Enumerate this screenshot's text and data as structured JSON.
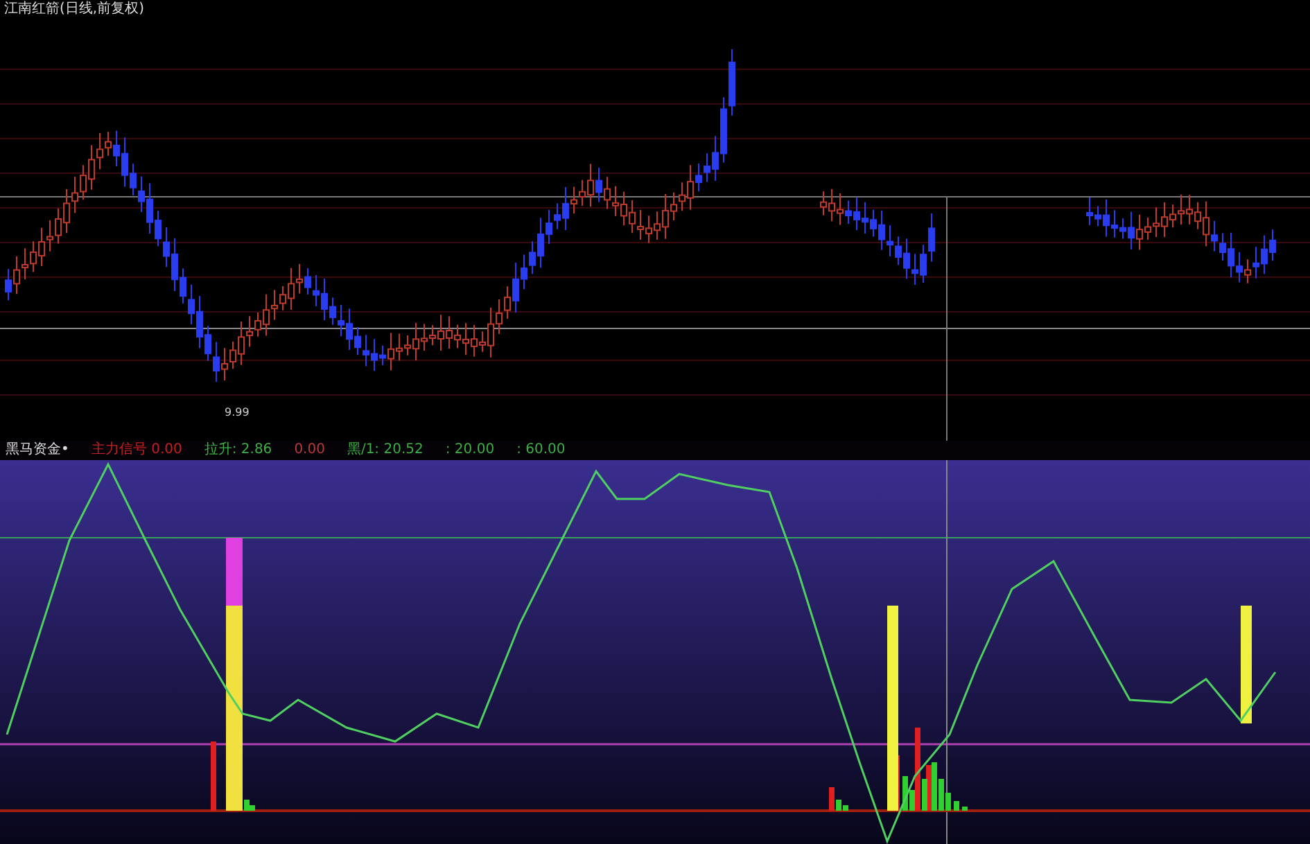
{
  "window": {
    "title": "江南红箭(日线,前复权)"
  },
  "price_chart": {
    "low_label": "9.99"
  },
  "indicator": {
    "name": "黑马资金•",
    "values": [
      {
        "text": "主力信号 0.00",
        "color": "#c82020"
      },
      {
        "text": "拉升: 2.86",
        "color": "#3cb043"
      },
      {
        "text": "0.00",
        "color": "#b83a3a"
      },
      {
        "text": "黑/1: 20.52",
        "color": "#3cb043"
      },
      {
        "text": ": 20.00",
        "color": "#3cb043"
      },
      {
        "text": ": 60.00",
        "color": "#3cb043"
      }
    ]
  }
}
